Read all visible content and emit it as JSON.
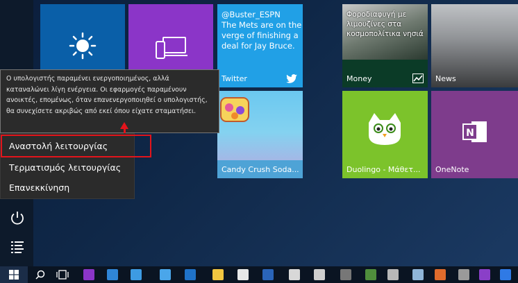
{
  "tooltip": {
    "text": "Ο υπολογιστής παραμένει ενεργοποιημένος, αλλά καταναλώνει λίγη ενέργεια. Οι εφαρμογές παραμένουν ανοικτές, επομένως, όταν επανενεργοποιηθεί ο υπολογιστής, θα συνεχίσετε ακριβώς από εκεί όπου είχατε σταματήσει."
  },
  "power_menu": {
    "items": [
      {
        "label": "Αναστολή λειτουργίας"
      },
      {
        "label": "Τερματισμός λειτουργίας"
      },
      {
        "label": "Επανεκκίνηση"
      }
    ]
  },
  "tiles": {
    "twitter": {
      "handle": "@Buster_ESPN",
      "body": "The Mets are on the verge of finishing a deal for Jay Bruce.",
      "label": "Twitter"
    },
    "money": {
      "headline": "Φοροδιαφυγή με λιμουζίνες στα κοσμοπολίτικα νησιά",
      "label": "Money"
    },
    "news": {
      "label": "News"
    },
    "candy": {
      "label": "Candy Crush Soda..."
    },
    "duolingo": {
      "label": "Duolingo - Μάθετ..."
    },
    "onenote": {
      "label": "OneNote"
    }
  },
  "colors": {
    "highlight": "#e3141b",
    "twitter": "#21a0e6",
    "purple": "#8b35c8",
    "blue": "#0a5fa8",
    "duolingo": "#7cc32b",
    "onenote": "#7e3c8c"
  },
  "icons": {
    "rail": [
      "power-icon",
      "all-apps-icon"
    ],
    "taskbar": [
      "windows-logo-icon",
      "search-icon",
      "task-view-icon"
    ]
  }
}
